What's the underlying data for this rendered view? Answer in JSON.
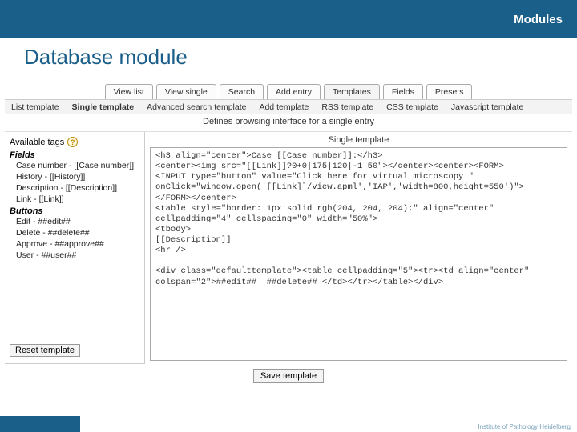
{
  "header": {
    "section": "Modules",
    "title": "Database module"
  },
  "tabs": {
    "row1": [
      "View list",
      "View single",
      "Search",
      "Add entry",
      "Templates",
      "Fields",
      "Presets"
    ],
    "row2": [
      "List template",
      "Single template",
      "Advanced search template",
      "Add template",
      "RSS template",
      "CSS template",
      "Javascript template"
    ],
    "active1": 4,
    "active2": 1
  },
  "description": "Defines browsing interface for a single entry",
  "left": {
    "header": "Available tags",
    "group_fields": "Fields",
    "fields": [
      "Case number - [[Case number]]",
      "History - [[History]]",
      "Description - [[Description]]",
      "Link - [[Link]]"
    ],
    "group_buttons": "Buttons",
    "buttons": [
      "Edit - ##edit##",
      "Delete - ##delete##",
      "Approve - ##approve##",
      "User - ##user##"
    ],
    "reset": "Reset template"
  },
  "right": {
    "header": "Single template",
    "code": "<h3 align=\"center\">Case [[Case number]]:</h3>\n<center><img src=\"[[Link]]?0+0|175|120|-1|50\"></center><center><FORM>\n<INPUT type=\"button\" value=\"Click here for virtual microscopy!\"\nonClick=\"window.open('[[Link]]/view.apml','IAP','width=800,height=550')\">\n</FORM></center>\n<table style=\"border: 1px solid rgb(204, 204, 204);\" align=\"center\"\ncellpadding=\"4\" cellspacing=\"0\" width=\"50%\">\n<tbody>\n[[Description]]\n<hr />\n\n<div class=\"defaulttemplate\"><table cellpadding=\"5\"><tr><td align=\"center\"\ncolspan=\"2\">##edit##  ##delete## </td></tr></table></div>"
  },
  "save": "Save template",
  "footnote": "Institute of Pathology Heidelberg"
}
